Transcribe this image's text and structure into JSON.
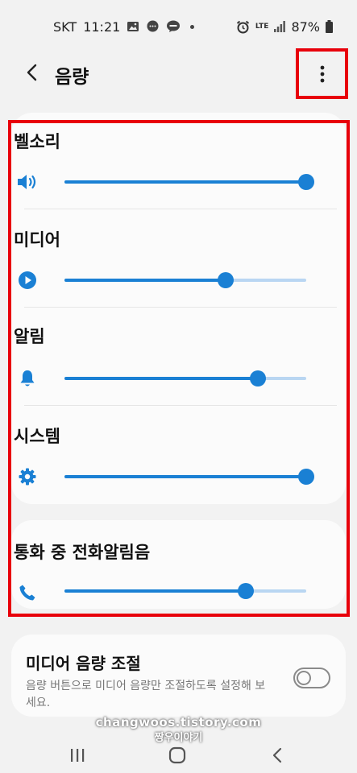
{
  "status_bar": {
    "carrier": "SKT",
    "time": "11:21",
    "network": "LTE",
    "battery": "87%",
    "icons": [
      "gallery-icon",
      "chat-icon",
      "talk-icon",
      "alarm-icon",
      "signal-icon",
      "battery-icon"
    ]
  },
  "header": {
    "title": "음량",
    "back_icon": "chevron-left-icon",
    "more_icon": "more-vertical-icon"
  },
  "volumes": [
    {
      "label": "벨소리",
      "icon": "speaker-icon",
      "level": 1.0
    },
    {
      "label": "미디어",
      "icon": "play-icon",
      "level": 0.665
    },
    {
      "label": "알림",
      "icon": "bell-icon",
      "level": 0.8
    },
    {
      "label": "시스템",
      "icon": "gear-icon",
      "level": 1.0
    }
  ],
  "call_volume": {
    "label": "통화 중 전화알림음",
    "icon": "phone-icon",
    "level": 0.75
  },
  "media_control": {
    "title": "미디어 음량 조절",
    "description": "음량 버튼으로 미디어 음량만 조절하도록 설정해 보세요.",
    "enabled": false
  },
  "watermark": {
    "line1": "changwoos.tistory.com",
    "line2": "짱우이야기"
  },
  "colors": {
    "accent": "#1a80d4",
    "track": "#b9d6f2",
    "highlight": "#e8000b",
    "background": "#f2f2f2",
    "card": "#fbfbfb"
  }
}
